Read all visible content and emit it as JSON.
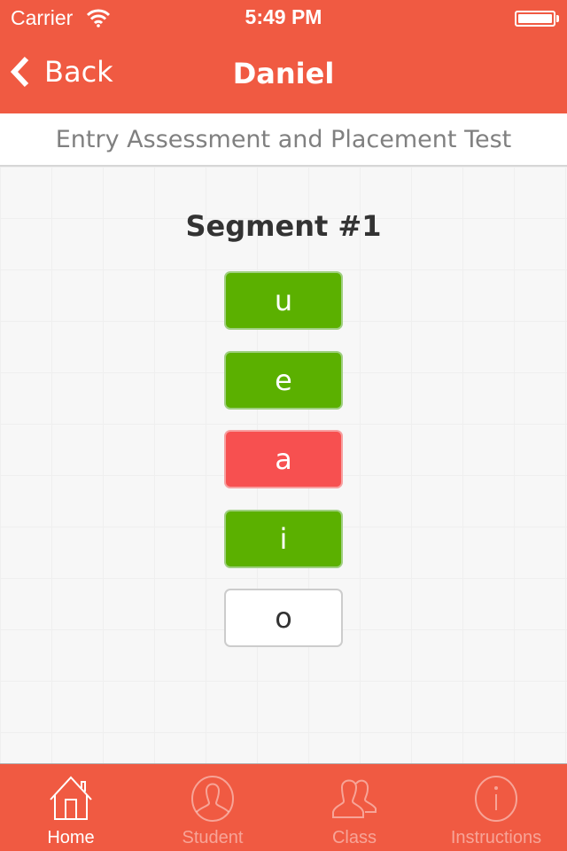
{
  "status_bar": {
    "carrier": "Carrier",
    "time": "5:49 PM",
    "wifi_icon": "wifi-icon",
    "battery_icon": "battery-icon",
    "battery_level": 1.0
  },
  "nav": {
    "back_label": "Back",
    "back_icon": "chevron-left-icon",
    "title": "Daniel"
  },
  "subheader": {
    "title": "Entry Assessment and Placement Test"
  },
  "segment": {
    "title": "Segment #1",
    "answers": [
      {
        "letter": "u",
        "state": "correct"
      },
      {
        "letter": "e",
        "state": "correct"
      },
      {
        "letter": "a",
        "state": "wrong"
      },
      {
        "letter": "i",
        "state": "correct"
      },
      {
        "letter": "o",
        "state": "pending"
      }
    ]
  },
  "colors": {
    "brand": "#f05a42",
    "correct": "#5bb000",
    "wrong": "#f75050",
    "pending": "#ffffff"
  },
  "tabbar": {
    "tabs": [
      {
        "label": "Home",
        "icon": "home-icon",
        "active": true
      },
      {
        "label": "Student",
        "icon": "student-icon",
        "active": false
      },
      {
        "label": "Class",
        "icon": "class-icon",
        "active": false
      },
      {
        "label": "Instructions",
        "icon": "info-icon",
        "active": false
      }
    ]
  }
}
